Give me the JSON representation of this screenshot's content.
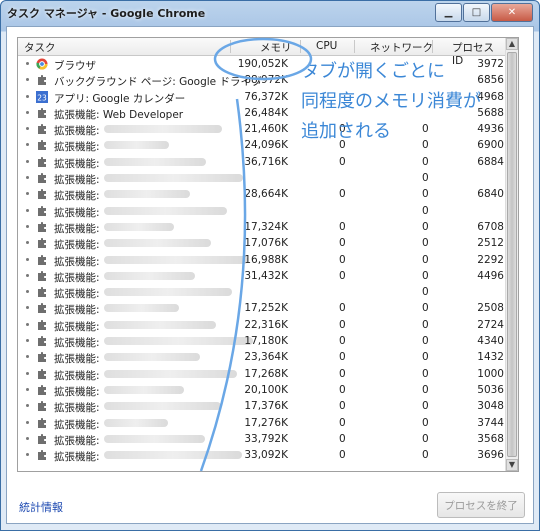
{
  "window": {
    "title": "タスク マネージャ - Google Chrome"
  },
  "columns": {
    "task": "タスク",
    "memory": "メモリ",
    "cpu": "CPU",
    "network": "ネットワーク",
    "pid": "プロセス ID"
  },
  "rows": [
    {
      "icon": "chrome-icon",
      "name": "ブラウザ",
      "mem": "190,052K",
      "cpu": "",
      "net": "",
      "pid": "3972"
    },
    {
      "icon": "puzzle-icon",
      "name": "バックグラウンド ページ: Google ドライブ",
      "mem": "88,972K",
      "cpu": "",
      "net": "",
      "pid": "6856"
    },
    {
      "icon": "calendar-icon",
      "name": "アプリ: Google カレンダー",
      "mem": "76,372K",
      "cpu": "",
      "net": "",
      "pid": "4968"
    },
    {
      "icon": "puzzle-icon",
      "name": "拡張機能: Web Developer",
      "mem": "26,484K",
      "cpu": "",
      "net": "",
      "pid": "5688"
    },
    {
      "icon": "puzzle-icon",
      "name": "拡張機能:",
      "mem": "21,460K",
      "cpu": "0",
      "net": "0",
      "pid": "4936"
    },
    {
      "icon": "puzzle-icon",
      "name": "拡張機能:",
      "mem": "24,096K",
      "cpu": "0",
      "net": "0",
      "pid": "6900"
    },
    {
      "icon": "puzzle-icon",
      "name": "拡張機能:",
      "mem": "36,716K",
      "cpu": "0",
      "net": "0",
      "pid": "6884"
    },
    {
      "icon": "puzzle-icon",
      "name": "拡張機能:",
      "mem": "",
      "cpu": "",
      "net": "0",
      "pid": ""
    },
    {
      "icon": "puzzle-icon",
      "name": "拡張機能:",
      "mem": "28,664K",
      "cpu": "0",
      "net": "0",
      "pid": "6840"
    },
    {
      "icon": "puzzle-icon",
      "name": "拡張機能:",
      "mem": "",
      "cpu": "",
      "net": "0",
      "pid": ""
    },
    {
      "icon": "puzzle-icon",
      "name": "拡張機能:",
      "mem": "17,324K",
      "cpu": "0",
      "net": "0",
      "pid": "6708"
    },
    {
      "icon": "puzzle-icon",
      "name": "拡張機能:",
      "mem": "17,076K",
      "cpu": "0",
      "net": "0",
      "pid": "2512"
    },
    {
      "icon": "puzzle-icon",
      "name": "拡張機能:",
      "mem": "16,988K",
      "cpu": "0",
      "net": "0",
      "pid": "2292"
    },
    {
      "icon": "puzzle-icon",
      "name": "拡張機能:",
      "mem": "31,432K",
      "cpu": "0",
      "net": "0",
      "pid": "4496"
    },
    {
      "icon": "puzzle-icon",
      "name": "拡張機能:",
      "mem": "",
      "cpu": "",
      "net": "0",
      "pid": ""
    },
    {
      "icon": "puzzle-icon",
      "name": "拡張機能:",
      "mem": "17,252K",
      "cpu": "0",
      "net": "0",
      "pid": "2508"
    },
    {
      "icon": "puzzle-icon",
      "name": "拡張機能:",
      "mem": "22,316K",
      "cpu": "0",
      "net": "0",
      "pid": "2724"
    },
    {
      "icon": "puzzle-icon",
      "name": "拡張機能:",
      "mem": "17,180K",
      "cpu": "0",
      "net": "0",
      "pid": "4340"
    },
    {
      "icon": "puzzle-icon",
      "name": "拡張機能:",
      "mem": "23,364K",
      "cpu": "0",
      "net": "0",
      "pid": "1432"
    },
    {
      "icon": "puzzle-icon",
      "name": "拡張機能:",
      "mem": "17,268K",
      "cpu": "0",
      "net": "0",
      "pid": "1000"
    },
    {
      "icon": "puzzle-icon",
      "name": "拡張機能:",
      "mem": "20,100K",
      "cpu": "0",
      "net": "0",
      "pid": "5036"
    },
    {
      "icon": "puzzle-icon",
      "name": "拡張機能:",
      "mem": "17,376K",
      "cpu": "0",
      "net": "0",
      "pid": "3048"
    },
    {
      "icon": "puzzle-icon",
      "name": "拡張機能:",
      "mem": "17,276K",
      "cpu": "0",
      "net": "0",
      "pid": "3744"
    },
    {
      "icon": "puzzle-icon",
      "name": "拡張機能:",
      "mem": "33,792K",
      "cpu": "0",
      "net": "0",
      "pid": "3568"
    },
    {
      "icon": "puzzle-icon",
      "name": "拡張機能:",
      "mem": "33,092K",
      "cpu": "0",
      "net": "0",
      "pid": "3696"
    }
  ],
  "footer": {
    "stats_link": "統計情報",
    "end_process": "プロセスを終了"
  },
  "annotation": {
    "line1": "タブが開くごとに",
    "line2": "同程度のメモリ消費が",
    "line3": "追加される"
  },
  "colors": {
    "annotation": "#3b87d6",
    "link": "#1a47b0"
  }
}
